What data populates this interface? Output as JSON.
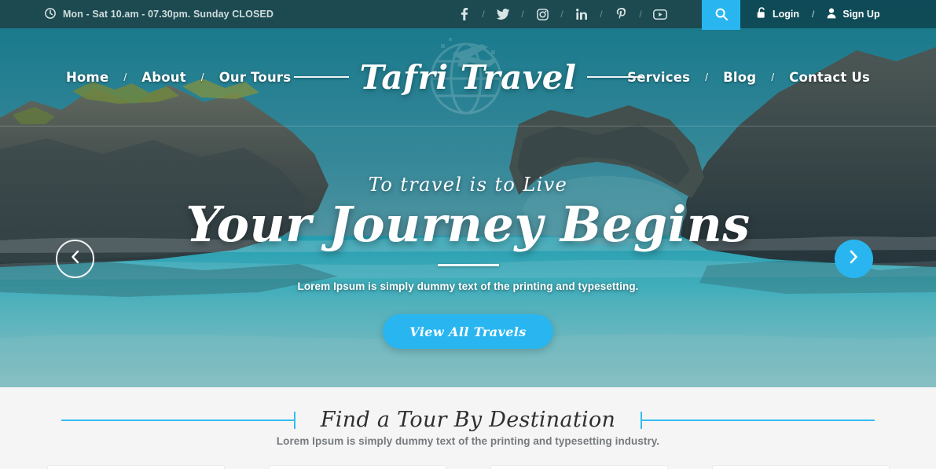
{
  "topbar": {
    "hours_icon": "clock-icon",
    "hours": "Mon - Sat 10.am - 07.30pm. Sunday CLOSED",
    "socials": [
      {
        "name": "facebook",
        "icon": "facebook-icon"
      },
      {
        "name": "twitter",
        "icon": "twitter-icon"
      },
      {
        "name": "instagram",
        "icon": "instagram-icon"
      },
      {
        "name": "linkedin",
        "icon": "linkedin-icon"
      },
      {
        "name": "pinterest",
        "icon": "pinterest-icon"
      },
      {
        "name": "youtube",
        "icon": "youtube-icon"
      }
    ],
    "social_separator": "/",
    "search_icon": "search-icon",
    "login": {
      "label": "Login",
      "icon": "unlock-icon"
    },
    "auth_separator": "/",
    "signup": {
      "label": "Sign Up",
      "icon": "user-icon"
    }
  },
  "nav": {
    "left": [
      {
        "label": "Home"
      },
      {
        "label": "About"
      },
      {
        "label": "Our Tours"
      }
    ],
    "right": [
      {
        "label": "Services"
      },
      {
        "label": "Blog"
      },
      {
        "label": "Contact Us"
      }
    ],
    "separator": "/"
  },
  "brand": {
    "name": "Tafri Travel",
    "watermark_icon": "globe-airplane-icon"
  },
  "hero": {
    "kicker": "To travel is to Live",
    "title": "Your Journey Begins",
    "subtitle": "Lorem Ipsum is simply dummy text of the printing and typesetting.",
    "cta_label": "View All Travels",
    "prev_icon": "chevron-left-icon",
    "next_icon": "chevron-right-icon"
  },
  "destination": {
    "title": "Find a Tour By Destination",
    "subtitle": "Lorem Ipsum is simply dummy text of the printing and typesetting industry."
  },
  "colors": {
    "accent": "#29b6f0",
    "accent_line": "#34bdf2",
    "topbar_bg": "#1d4a51",
    "section_bg": "#f5f5f6",
    "heading": "#2f2f2f",
    "muted_text": "#777b7e"
  }
}
